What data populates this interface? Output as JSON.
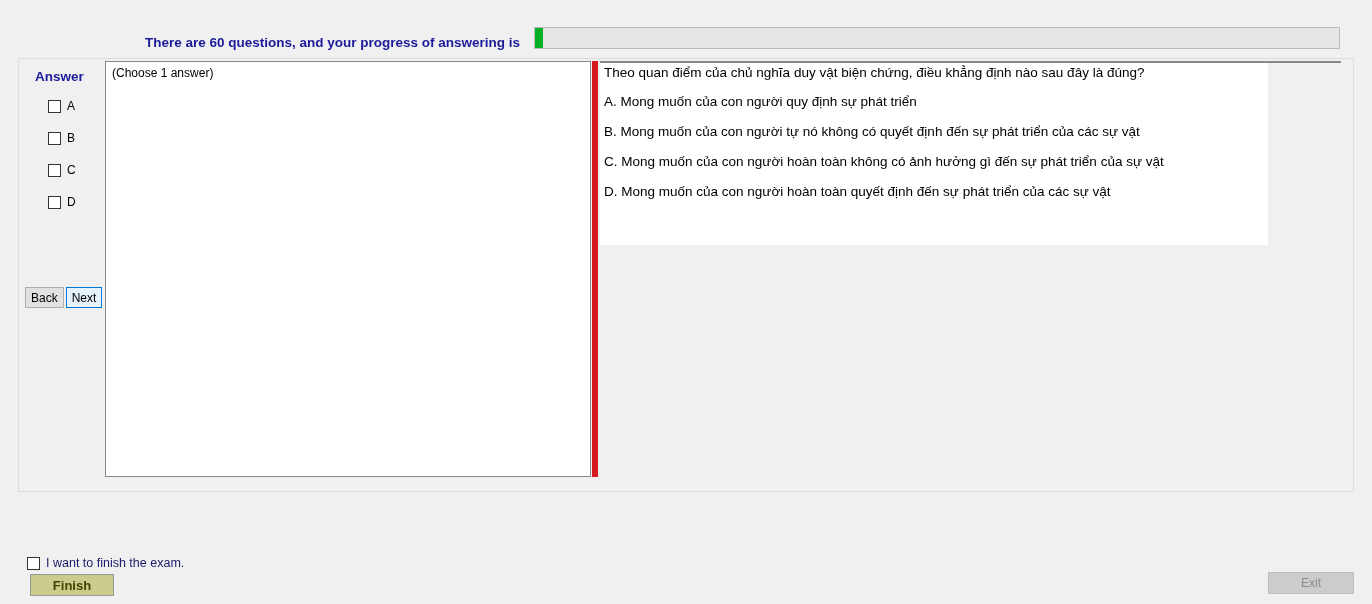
{
  "header": {
    "text": "There are 60 questions, and your progress of answering is",
    "progress": {
      "level": 0.01
    }
  },
  "answer_panel": {
    "title": "Answer",
    "options": [
      {
        "label": "A",
        "checked": false
      },
      {
        "label": "B",
        "checked": false
      },
      {
        "label": "C",
        "checked": false
      },
      {
        "label": "D",
        "checked": false
      }
    ]
  },
  "navigation": [
    {
      "label": "Back",
      "focused": false
    },
    {
      "label": "Next",
      "focused": true
    }
  ],
  "answer_box": {
    "text": "(Choose 1 answer)"
  },
  "question": {
    "text": "Theo quan điểm của chủ nghĩa duy vật biện chứng, điều khẳng định nào sau đây là đúng?",
    "choices": [
      "A.  Mong muốn của con người quy định sự phát triển",
      "B.  Mong muốn của con người tự nó không có quyết định đến sự phát triển của các sự vật",
      "C.  Mong muốn của con người hoàn toàn không có ảnh hưởng gì đến sự phát triển của sự vật",
      "D.  Mong muốn của con người hoàn toàn quyết định đến sự phát triển của các sự vật"
    ]
  },
  "footer": {
    "confirm": {
      "label": "I want to finish the exam.",
      "checked": false
    },
    "finish_button": {
      "label": "Finish",
      "disabled": false
    },
    "exit_button": {
      "label": "Exit",
      "disabled": true
    }
  }
}
